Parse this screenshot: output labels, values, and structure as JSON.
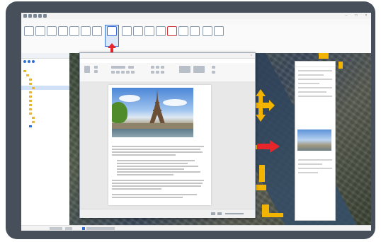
{
  "colors": {
    "frame": "#464f5a",
    "accent_blue": "#2b579a",
    "highlight_red": "#e8252a",
    "marker_yellow": "#f2b400"
  },
  "icons": {
    "annotation_arrow": "red-arrow-icon",
    "move_cross": "yellow-cross-arrows-icon",
    "point_arrow": "red-right-arrow-icon"
  },
  "photo": {
    "subject": "eiffel-tower-photo"
  }
}
